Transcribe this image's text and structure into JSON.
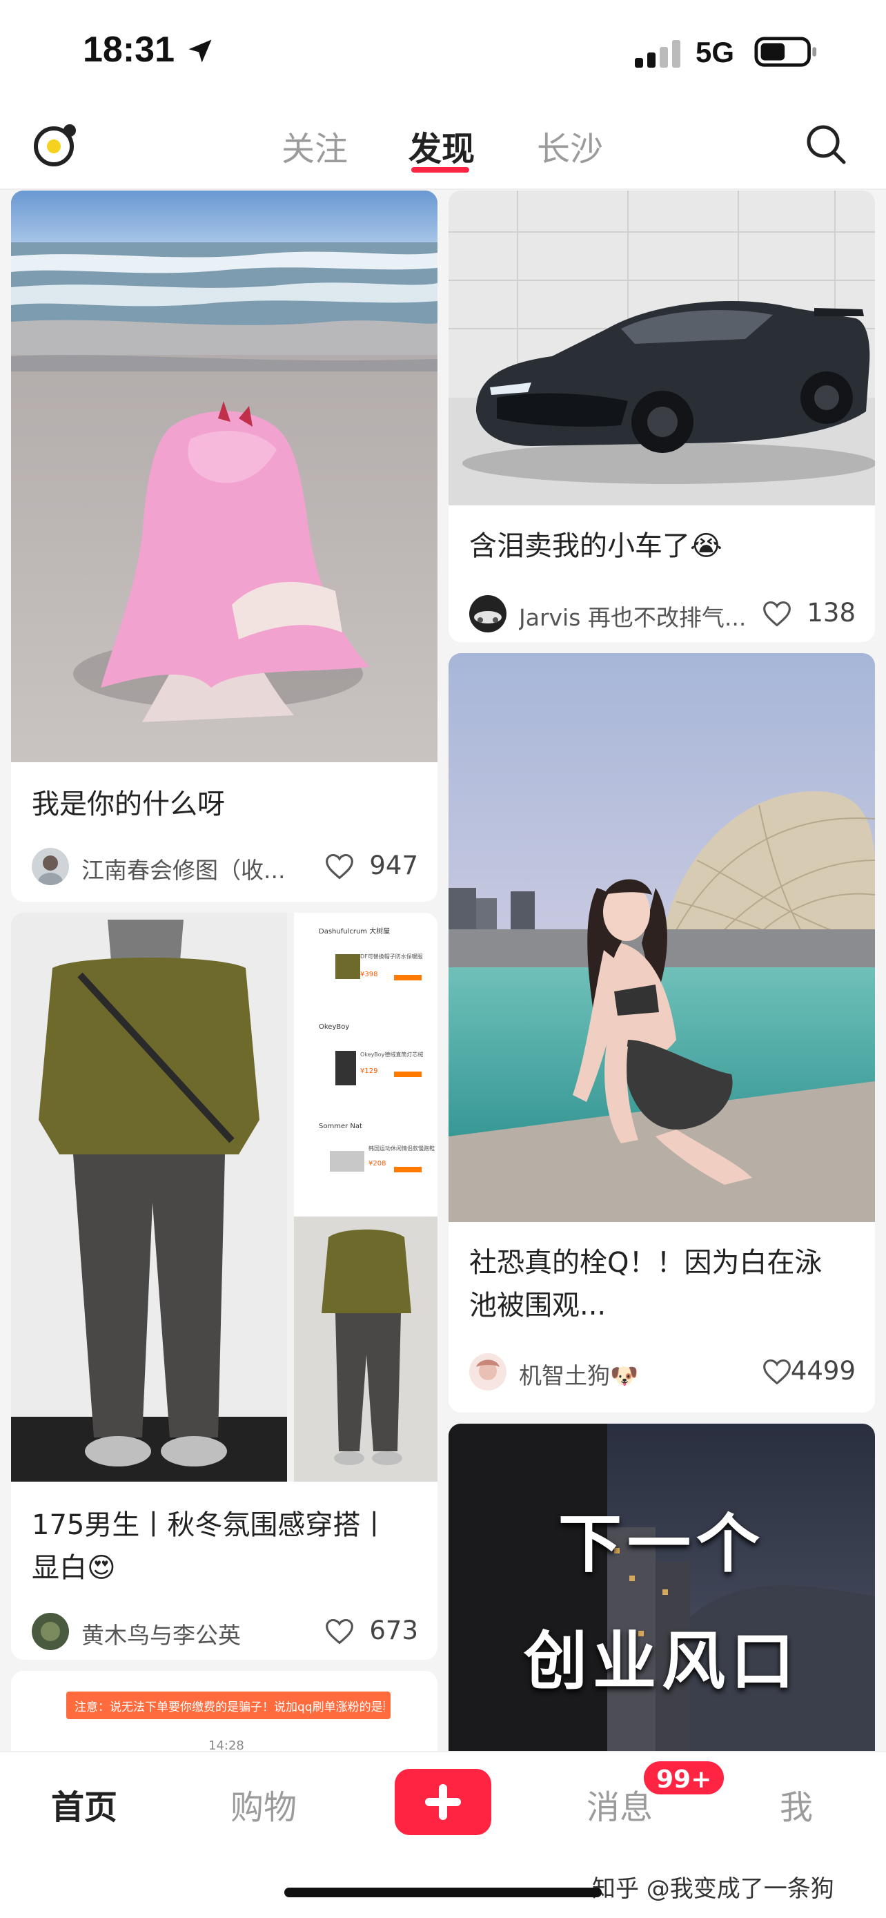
{
  "status_bar": {
    "time": "18:31",
    "network": "5G"
  },
  "top_nav": {
    "tabs": [
      {
        "label": "关注"
      },
      {
        "label": "发现",
        "active": true
      },
      {
        "label": "长沙"
      }
    ]
  },
  "feed": {
    "cards": [
      {
        "title": "我是你的什么呀",
        "author": "江南春会修图（收...",
        "likes": "947"
      },
      {
        "title": "含泪卖我的小车了😭",
        "author": "Jarvis 再也不改排气...",
        "likes": "138"
      },
      {
        "title_line1": "社恐真的栓Q！！因为白在泳",
        "title_line2": "池被围观...",
        "author": "机智土狗🐶",
        "likes": "4499"
      },
      {
        "title_line1": "175男生丨秋冬氛围感穿搭丨",
        "title_line2": "显白😍",
        "author": "黄木鸟与李公英",
        "likes": "673"
      },
      {
        "image_text_line1": "下一个",
        "image_text_line2": "创业风口"
      },
      {
        "banner_text": "注意：说无法下单要你缴费的是骗子！说加qq刷单涨粉的是骗",
        "banner_time": "14:28"
      }
    ],
    "shopping_list": [
      {
        "shop": "Dashufulcrum 大树屋",
        "item": "DF可替换帽子防水保暖服",
        "price": "¥398"
      },
      {
        "shop": "OkeyBoy",
        "item": "OkeyBoy德绒直筒灯芯绒",
        "price": "¥129"
      },
      {
        "shop": "Sommer Nat",
        "item": "韩国运动休闲情侣款慢跑鞋",
        "price": "¥208"
      }
    ]
  },
  "bottom_bar": {
    "tabs": [
      {
        "label": "首页",
        "active": true
      },
      {
        "label": "购物"
      },
      {
        "label": "消息"
      },
      {
        "label": "我"
      }
    ],
    "message_badge": "99+",
    "watermark": "知乎 @我变成了一条狗"
  },
  "colors": {
    "accent": "#ff2442"
  }
}
